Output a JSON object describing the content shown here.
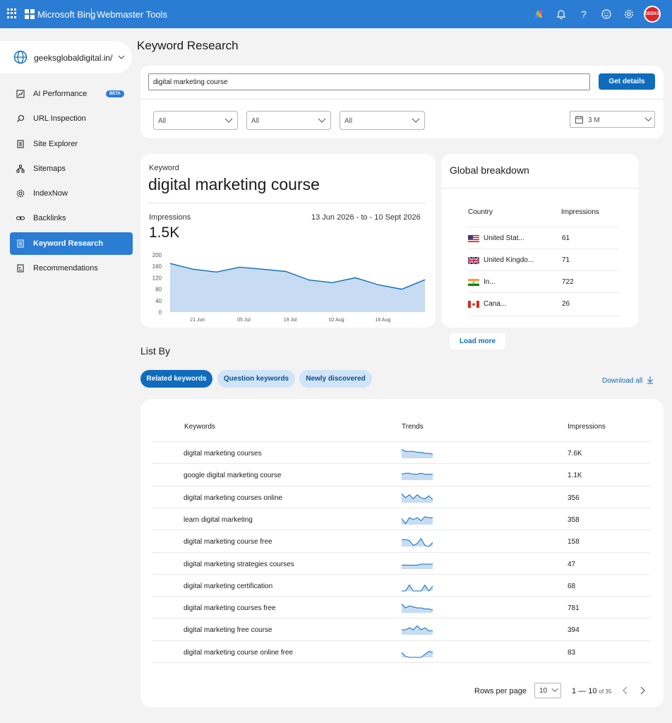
{
  "topbar": {
    "brand": "Microsoft Bing",
    "product": "Webmaster Tools",
    "avatar_text": "GEEKS"
  },
  "site": {
    "name": "geeksglobaldigital.in/"
  },
  "sidebar": {
    "items": [
      {
        "label": "AI Performance",
        "badge": "BETA",
        "icon": "chart-icon",
        "active": false
      },
      {
        "label": "URL Inspection",
        "icon": "search-icon",
        "active": false
      },
      {
        "label": "Site Explorer",
        "icon": "document-icon",
        "active": false
      },
      {
        "label": "Sitemaps",
        "icon": "sitemap-icon",
        "active": false
      },
      {
        "label": "IndexNow",
        "icon": "gear-icon",
        "active": false
      },
      {
        "label": "Backlinks",
        "icon": "link-icon",
        "active": false
      },
      {
        "label": "Keyword Research",
        "icon": "document-icon",
        "active": true
      },
      {
        "label": "Recommendations",
        "icon": "list-check-icon",
        "active": false
      }
    ]
  },
  "main": {
    "title": "Keyword Research",
    "search": {
      "value": "digital marketing course",
      "button": "Get details"
    },
    "filters": [
      "All",
      "All",
      "All"
    ],
    "date_filter": "3 M"
  },
  "keyword_card": {
    "label": "Keyword",
    "keyword": "digital marketing course",
    "impressions_label": "Impressions",
    "date_range": "13 Jun 2026 - to - 10 Sept 2026",
    "impressions": "1.5K"
  },
  "chart_data": {
    "type": "area",
    "x_tick_labels": [
      "21 Jun",
      "05 Jul",
      "19 Jul",
      "02 Aug",
      "16 Aug"
    ],
    "y_ticks": [
      0,
      40,
      80,
      120,
      160,
      200
    ],
    "ylim": [
      0,
      200
    ],
    "x": [
      "13 Jun",
      "21 Jun",
      "28 Jun",
      "05 Jul",
      "12 Jul",
      "19 Jul",
      "26 Jul",
      "02 Aug",
      "09 Aug",
      "16 Aug",
      "23 Aug",
      "30 Aug"
    ],
    "values": [
      170,
      150,
      140,
      157,
      150,
      142,
      112,
      103,
      120,
      95,
      80,
      113
    ],
    "color": "#0f6cbd",
    "fill": "#c7dcf2"
  },
  "global_breakdown": {
    "title": "Global breakdown",
    "col_country": "Country",
    "col_impressions": "Impressions",
    "rows": [
      {
        "country": "United Stat...",
        "flag": "us-flag-icon",
        "value": "61"
      },
      {
        "country": "United Kingdo...",
        "flag": "uk-flag-icon",
        "value": "71"
      },
      {
        "country": "In...",
        "flag": "india-flag-icon",
        "value": "722"
      },
      {
        "country": "Cana...",
        "flag": "canada-flag-icon",
        "value": "26"
      }
    ],
    "load_more": "Load more"
  },
  "list_by": {
    "title": "List By",
    "tabs": [
      "Related keywords",
      "Question keywords",
      "Newly discovered"
    ],
    "download": "Download all"
  },
  "table": {
    "headers": [
      "Keywords",
      "Trends",
      "Impressions"
    ],
    "rows": [
      {
        "keyword": "digital marketing courses",
        "impressions": "7.6K",
        "trend": [
          9,
          7,
          7,
          7,
          6,
          6,
          5,
          5,
          4
        ]
      },
      {
        "keyword": "google digital marketing course",
        "impressions": "1.1K",
        "trend": [
          6,
          7,
          7,
          6,
          6,
          7,
          6,
          6,
          6
        ]
      },
      {
        "keyword": "digital marketing courses online",
        "impressions": "356",
        "trend": [
          9,
          5,
          8,
          4,
          8,
          5,
          4,
          7,
          3
        ]
      },
      {
        "keyword": "learn digital marketing",
        "impressions": "358",
        "trend": [
          6,
          1,
          7,
          5,
          7,
          4,
          8,
          7,
          7
        ]
      },
      {
        "keyword": "digital marketing course free",
        "impressions": "158",
        "trend": [
          7,
          7,
          6,
          1,
          3,
          8,
          1,
          0,
          4
        ]
      },
      {
        "keyword": "digital marketing strategies courses",
        "impressions": "47",
        "trend": [
          4,
          4,
          4,
          4,
          4,
          5,
          5,
          5,
          5
        ]
      },
      {
        "keyword": "digital marketing certification",
        "impressions": "68",
        "trend": [
          0,
          0,
          6,
          0,
          0,
          0,
          6,
          0,
          5
        ]
      },
      {
        "keyword": "digital marketing courses free",
        "impressions": "781",
        "trend": [
          9,
          5,
          7,
          6,
          5,
          5,
          4,
          4,
          3
        ]
      },
      {
        "keyword": "digital marketing free course",
        "impressions": "394",
        "trend": [
          5,
          5,
          7,
          5,
          9,
          5,
          7,
          4,
          4
        ]
      },
      {
        "keyword": "digital marketing course online free",
        "impressions": "83",
        "trend": [
          5,
          1,
          0,
          0,
          0,
          0,
          3,
          6,
          5
        ]
      }
    ],
    "rows_per_page_label": "Rows per page",
    "rows_per_page": "10",
    "range": "1 — 10",
    "of_total": "of 35"
  },
  "colors": {
    "topbar": "#2b7cd3",
    "accent": "#0f6cbd",
    "page_bg": "#f3f3f3"
  }
}
